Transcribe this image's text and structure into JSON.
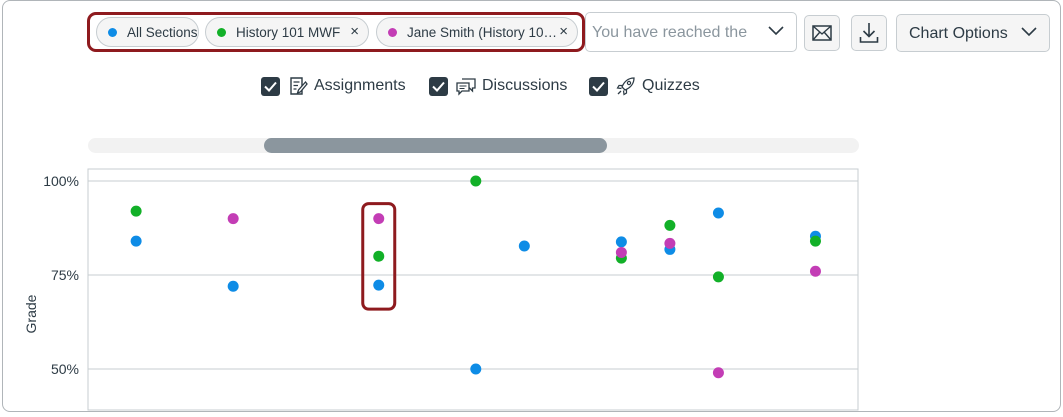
{
  "sections_filter": {
    "chips": [
      {
        "label": "All Sections",
        "color": "#0e8ce6",
        "removable": false
      },
      {
        "label": "History 101 MWF",
        "color": "#12b028",
        "removable": true
      },
      {
        "label": "Jane Smith (History 10…",
        "color": "#c33db5",
        "removable": true
      }
    ],
    "remove_symbol": "×",
    "search_placeholder": "You have reached the ma"
  },
  "toolbar": {
    "mail_icon": "envelope-icon",
    "download_icon": "download-icon",
    "chart_options_label": "Chart Options"
  },
  "filters": {
    "items": [
      {
        "label": "Assignments",
        "checked": true,
        "icon": "assignment-icon"
      },
      {
        "label": "Discussions",
        "checked": true,
        "icon": "discussion-icon"
      },
      {
        "label": "Quizzes",
        "checked": true,
        "icon": "quiz-rocket-icon"
      }
    ]
  },
  "colors": {
    "all_sections": "#0e8ce6",
    "history_101_mwf": "#12b028",
    "jane_smith": "#c33db5",
    "highlight": "#8e1a1e"
  },
  "chart_data": {
    "type": "scatter",
    "ylabel": "Grade",
    "ylim": [
      47,
      103
    ],
    "yticks": [
      {
        "value": 100,
        "label": "100%"
      },
      {
        "value": 75,
        "label": "75%"
      },
      {
        "value": 50,
        "label": "50%"
      }
    ],
    "grid": true,
    "x_count": 8,
    "series": [
      {
        "color_key": "all_sections",
        "values": [
          84,
          72,
          72.3,
          50,
          82.7,
          83.8,
          81.8,
          91.5,
          85.3
        ]
      },
      {
        "color_key": "history_101_mwf",
        "values": [
          92,
          null,
          80,
          100,
          null,
          79.5,
          88.2,
          74.5,
          84
        ]
      },
      {
        "color_key": "jane_smith",
        "values": [
          null,
          90,
          90,
          null,
          null,
          81,
          83.4,
          49,
          76
        ]
      }
    ],
    "x_positions": [
      1,
      2,
      3.5,
      4.5,
      5,
      6,
      6.5,
      7,
      8
    ],
    "highlighted_index": 2
  }
}
